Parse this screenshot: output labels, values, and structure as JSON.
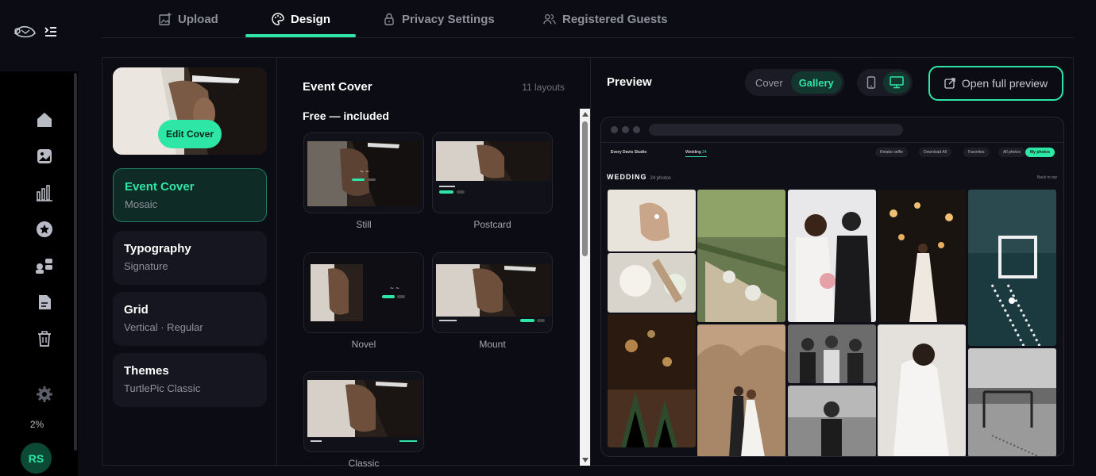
{
  "tabs": [
    {
      "label": "Upload",
      "icon": "image-plus-icon"
    },
    {
      "label": "Design",
      "icon": "palette-icon",
      "active": true
    },
    {
      "label": "Privacy Settings",
      "icon": "lock-icon"
    },
    {
      "label": "Registered Guests",
      "icon": "users-icon"
    }
  ],
  "sidebar": {
    "items": [
      "home-icon",
      "image-icon",
      "chart-icon",
      "star-icon",
      "people-icon",
      "document-icon",
      "trash-icon",
      "settings-icon"
    ],
    "storage_pct": "2%",
    "avatar_initials": "RS"
  },
  "settings": {
    "edit_cover_label": "Edit Cover",
    "cards": [
      {
        "title": "Event Cover",
        "subtitle": "Mosaic",
        "active": true
      },
      {
        "title": "Typography",
        "subtitle": "Signature"
      },
      {
        "title": "Grid",
        "subtitle": "Vertical · Regular"
      },
      {
        "title": "Themes",
        "subtitle": "TurtlePic Classic"
      }
    ]
  },
  "layouts": {
    "title": "Event Cover",
    "count": "11 layouts",
    "section": "Free — included",
    "items": [
      "Still",
      "Postcard",
      "Novel",
      "Mount",
      "Classic"
    ]
  },
  "preview": {
    "title": "Preview",
    "mode_options": [
      "Cover",
      "Gallery"
    ],
    "mode_selected": "Gallery",
    "device_selected": "desktop",
    "open_full_label": "Open full preview",
    "site": {
      "brand": "Every Davis Studio",
      "tab": "Wedding",
      "tab_count": "24",
      "actions": [
        "Retake selfie",
        "Download All",
        "Favorites",
        "All photos",
        "My photos"
      ],
      "section": "WEDDING",
      "section_count": "24 photos",
      "back_to_top": "Back to top"
    }
  },
  "colors": {
    "accent": "#2ee6a6",
    "bg": "#0b0c14"
  }
}
